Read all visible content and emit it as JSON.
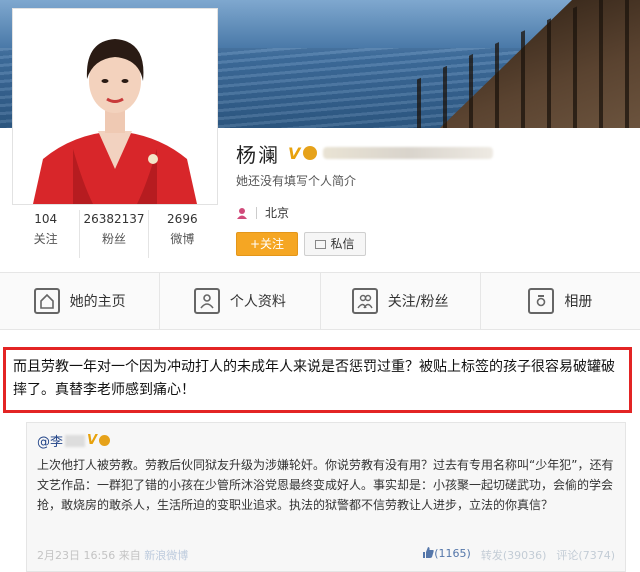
{
  "profile": {
    "name": "杨澜",
    "verified_badge": "V",
    "intro": "她还没有填写个人简介",
    "location": "北京",
    "follow_label": "+关注",
    "message_label": "私信"
  },
  "stats": [
    {
      "num": "104",
      "label": "关注"
    },
    {
      "num": "26382137",
      "label": "粉丝"
    },
    {
      "num": "2696",
      "label": "微博"
    }
  ],
  "nav": [
    {
      "label": "她的主页",
      "icon": "home-icon"
    },
    {
      "label": "个人资料",
      "icon": "person-icon"
    },
    {
      "label": "关注/粉丝",
      "icon": "people-icon"
    },
    {
      "label": "相册",
      "icon": "camera-icon"
    }
  ],
  "highlighted_post": {
    "text": "而且劳教一年对一个因为冲动打人的未成年人来说是否惩罚过重？被贴上标签的孩子很容易破罐破摔了。真替李老师感到痛心！"
  },
  "quoted_post": {
    "author": "@李",
    "verified_badge": "V",
    "body": "上次他打人被劳教。劳教后伙同狱友升级为涉嫌轮奸。你说劳教有没有用？过去有专用名称叫“少年犯”，还有文艺作品：一群犯了错的小孩在少管所沐浴党恩最终变成好人。事实却是：小孩聚一起切磋武功，会偷的学会抢，敢烧房的敢杀人，生活所迫的变职业追求。执法的狱警都不信劳教让人进步，立法的你真信？",
    "time": "2月23日 16:56",
    "source_prefix": "来自",
    "source": "新浪微博",
    "likes": "(1165)",
    "reposts": "转发(39036)",
    "comments": "评论(7374)"
  },
  "colors": {
    "accent_follow": "#f5a623",
    "highlight_border": "#e32424",
    "link_blue": "#224488"
  }
}
